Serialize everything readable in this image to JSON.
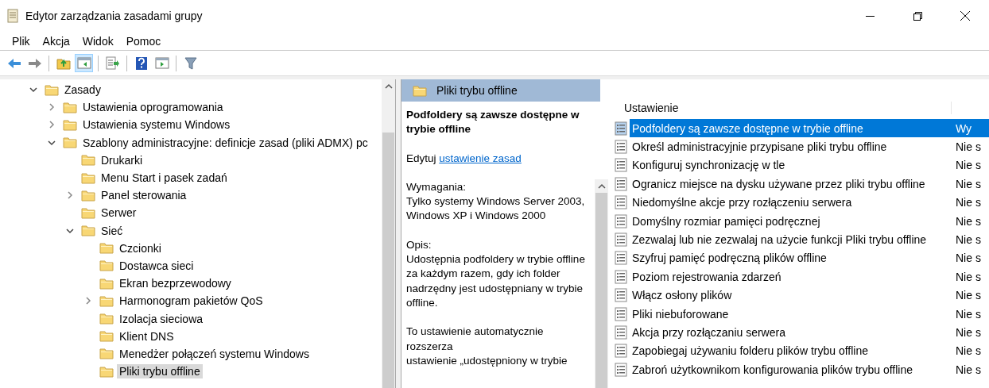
{
  "window": {
    "title": "Edytor zarządzania zasadami grupy"
  },
  "menu": [
    "Plik",
    "Akcja",
    "Widok",
    "Pomoc"
  ],
  "toolbar": [
    {
      "kind": "back",
      "selected": false
    },
    {
      "kind": "forward",
      "selected": false
    },
    {
      "kind": "sep"
    },
    {
      "kind": "up",
      "selected": false
    },
    {
      "kind": "tree",
      "selected": true
    },
    {
      "kind": "sep"
    },
    {
      "kind": "export",
      "selected": false
    },
    {
      "kind": "sep"
    },
    {
      "kind": "help",
      "selected": false
    },
    {
      "kind": "pane",
      "selected": false
    },
    {
      "kind": "sep"
    },
    {
      "kind": "filter",
      "selected": false
    }
  ],
  "tree": [
    {
      "label": "Zasady",
      "expanded": true,
      "selected": false,
      "children": [
        {
          "label": "Ustawienia oprogramowania",
          "expanded": false,
          "selected": false
        },
        {
          "label": "Ustawienia systemu Windows",
          "expanded": false,
          "selected": false
        },
        {
          "label": "Szablony administracyjne: definicje zasad (pliki ADMX) pc",
          "expanded": true,
          "selected": false,
          "children": [
            {
              "label": "Drukarki",
              "selected": false
            },
            {
              "label": "Menu Start i pasek zadań",
              "selected": false
            },
            {
              "label": "Panel sterowania",
              "expanded": false,
              "selected": false
            },
            {
              "label": "Serwer",
              "selected": false
            },
            {
              "label": "Sieć",
              "expanded": true,
              "selected": false,
              "children": [
                {
                  "label": "Czcionki",
                  "selected": false
                },
                {
                  "label": "Dostawca sieci",
                  "selected": false
                },
                {
                  "label": "Ekran bezprzewodowy",
                  "selected": false
                },
                {
                  "label": "Harmonogram pakietów QoS",
                  "expanded": false,
                  "selected": false
                },
                {
                  "label": "Izolacja sieciowa",
                  "selected": false
                },
                {
                  "label": "Klient DNS",
                  "selected": false
                },
                {
                  "label": "Menedżer połączeń systemu Windows",
                  "selected": false
                },
                {
                  "label": "Pliki trybu offline",
                  "selected": true
                }
              ]
            }
          ]
        }
      ]
    }
  ],
  "details": {
    "header": "Pliki trybu offline",
    "title": "Podfoldery są zawsze dostępne w trybie offline",
    "edit_prefix": "Edytuj",
    "edit_link": "ustawienie zasad",
    "requirements_label": "Wymagania:",
    "requirements": "Tylko systemy Windows Server 2003, Windows XP i Windows 2000",
    "description_label": "Opis:",
    "description": "Udostępnia podfoldery w trybie offline za każdym razem, gdy ich folder nadrzędny jest udostępniany w trybie offline.",
    "description_2": "To ustawienie automatycznie rozszerza\nustawienie „udostępniony w trybie"
  },
  "list": {
    "columns": [
      "Ustawienie"
    ],
    "rows": [
      {
        "name": "Podfoldery są zawsze dostępne w trybie offline",
        "state": "Wy",
        "selected": true
      },
      {
        "name": "Określ administracyjnie przypisane pliki trybu offline",
        "state": "Nie s",
        "selected": false
      },
      {
        "name": "Konfiguruj synchronizację w tle",
        "state": "Nie s",
        "selected": false
      },
      {
        "name": "Ogranicz miejsce na dysku używane przez pliki trybu offline",
        "state": "Nie s",
        "selected": false
      },
      {
        "name": "Niedomyślne akcje przy rozłączeniu serwera",
        "state": "Nie s",
        "selected": false
      },
      {
        "name": "Domyślny rozmiar pamięci podręcznej",
        "state": "Nie s",
        "selected": false
      },
      {
        "name": "Zezwalaj lub nie zezwalaj na użycie funkcji Pliki trybu offline",
        "state": "Nie s",
        "selected": false
      },
      {
        "name": "Szyfruj pamięć podręczną plików offline",
        "state": "Nie s",
        "selected": false
      },
      {
        "name": "Poziom rejestrowania zdarzeń",
        "state": "Nie s",
        "selected": false
      },
      {
        "name": "Włącz osłony plików",
        "state": "Nie s",
        "selected": false
      },
      {
        "name": "Pliki niebuforowane",
        "state": "Nie s",
        "selected": false
      },
      {
        "name": "Akcja przy rozłączaniu serwera",
        "state": "Nie s",
        "selected": false
      },
      {
        "name": "Zapobiegaj używaniu folderu plików trybu offline",
        "state": "Nie s",
        "selected": false
      },
      {
        "name": "Zabroń użytkownikom konfigurowania plików trybu offline",
        "state": "Nie s",
        "selected": false
      }
    ]
  }
}
